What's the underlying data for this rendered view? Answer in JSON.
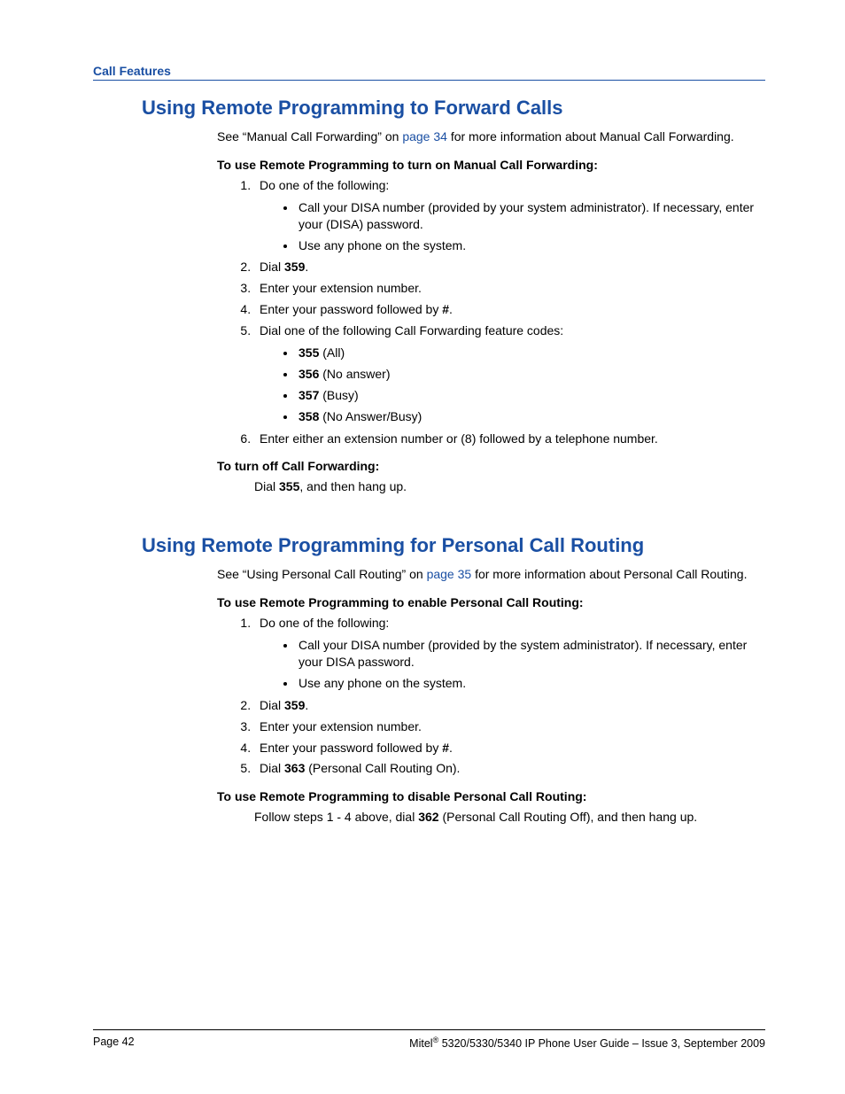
{
  "header": {
    "label": "Call Features"
  },
  "section1": {
    "title": "Using Remote Programming to Forward Calls",
    "intro_pre": "See “Manual Call Forwarding” on ",
    "intro_link": "page 34",
    "intro_post": " for more information about Manual Call Forwarding.",
    "proc1_title": "To use Remote Programming to turn on Manual Call Forwarding:",
    "step1": "Do one of the following:",
    "step1_b1": "Call your DISA number (provided by your system administrator). If necessary, enter your (DISA) password.",
    "step1_b2": "Use any phone on the system.",
    "step2_pre": "Dial ",
    "step2_bold": "359",
    "step2_post": ".",
    "step3": "Enter your extension number.",
    "step4_pre": "Enter your password followed by ",
    "step4_bold": "#",
    "step4_post": ".",
    "step5": "Dial one of the following Call Forwarding feature codes:",
    "step5_b1_bold": "355",
    "step5_b1_rest": " (All)",
    "step5_b2_bold": "356",
    "step5_b2_rest": " (No answer)",
    "step5_b3_bold": "357",
    "step5_b3_rest": " (Busy)",
    "step5_b4_bold": "358",
    "step5_b4_rest": " (No Answer/Busy)",
    "step6": "Enter either an extension number or (8) followed by a telephone number.",
    "proc2_title": "To turn off Call Forwarding:",
    "proc2_body_pre": "Dial ",
    "proc2_body_bold": "355",
    "proc2_body_post": ", and then hang up."
  },
  "section2": {
    "title": "Using Remote Programming for Personal Call Routing",
    "intro_pre": "See “Using Personal Call Routing” on ",
    "intro_link": "page 35",
    "intro_post": " for more information about Personal Call Routing.",
    "proc1_title": "To use Remote Programming to enable Personal Call Routing:",
    "step1": "Do one of the following:",
    "step1_b1": "Call your DISA number (provided by the system administrator). If necessary, enter your DISA password.",
    "step1_b2": "Use any phone on the system.",
    "step2_pre": "Dial ",
    "step2_bold": "359",
    "step2_post": ".",
    "step3": "Enter your extension number.",
    "step4_pre": "Enter your password followed by ",
    "step4_bold": "#",
    "step4_post": ".",
    "step5_pre": "Dial ",
    "step5_bold": "363",
    "step5_post": " (Personal Call Routing On).",
    "proc2_title": "To use Remote Programming to disable Personal Call Routing:",
    "proc2_body_pre": "Follow steps 1 - 4 above, dial ",
    "proc2_body_bold": "362",
    "proc2_body_post": " (Personal Call Routing Off), and then hang up."
  },
  "footer": {
    "left": "Page 42",
    "right_pre": "Mitel",
    "right_sup": "®",
    "right_post": " 5320/5330/5340 IP Phone User Guide  – Issue 3, September 2009"
  }
}
